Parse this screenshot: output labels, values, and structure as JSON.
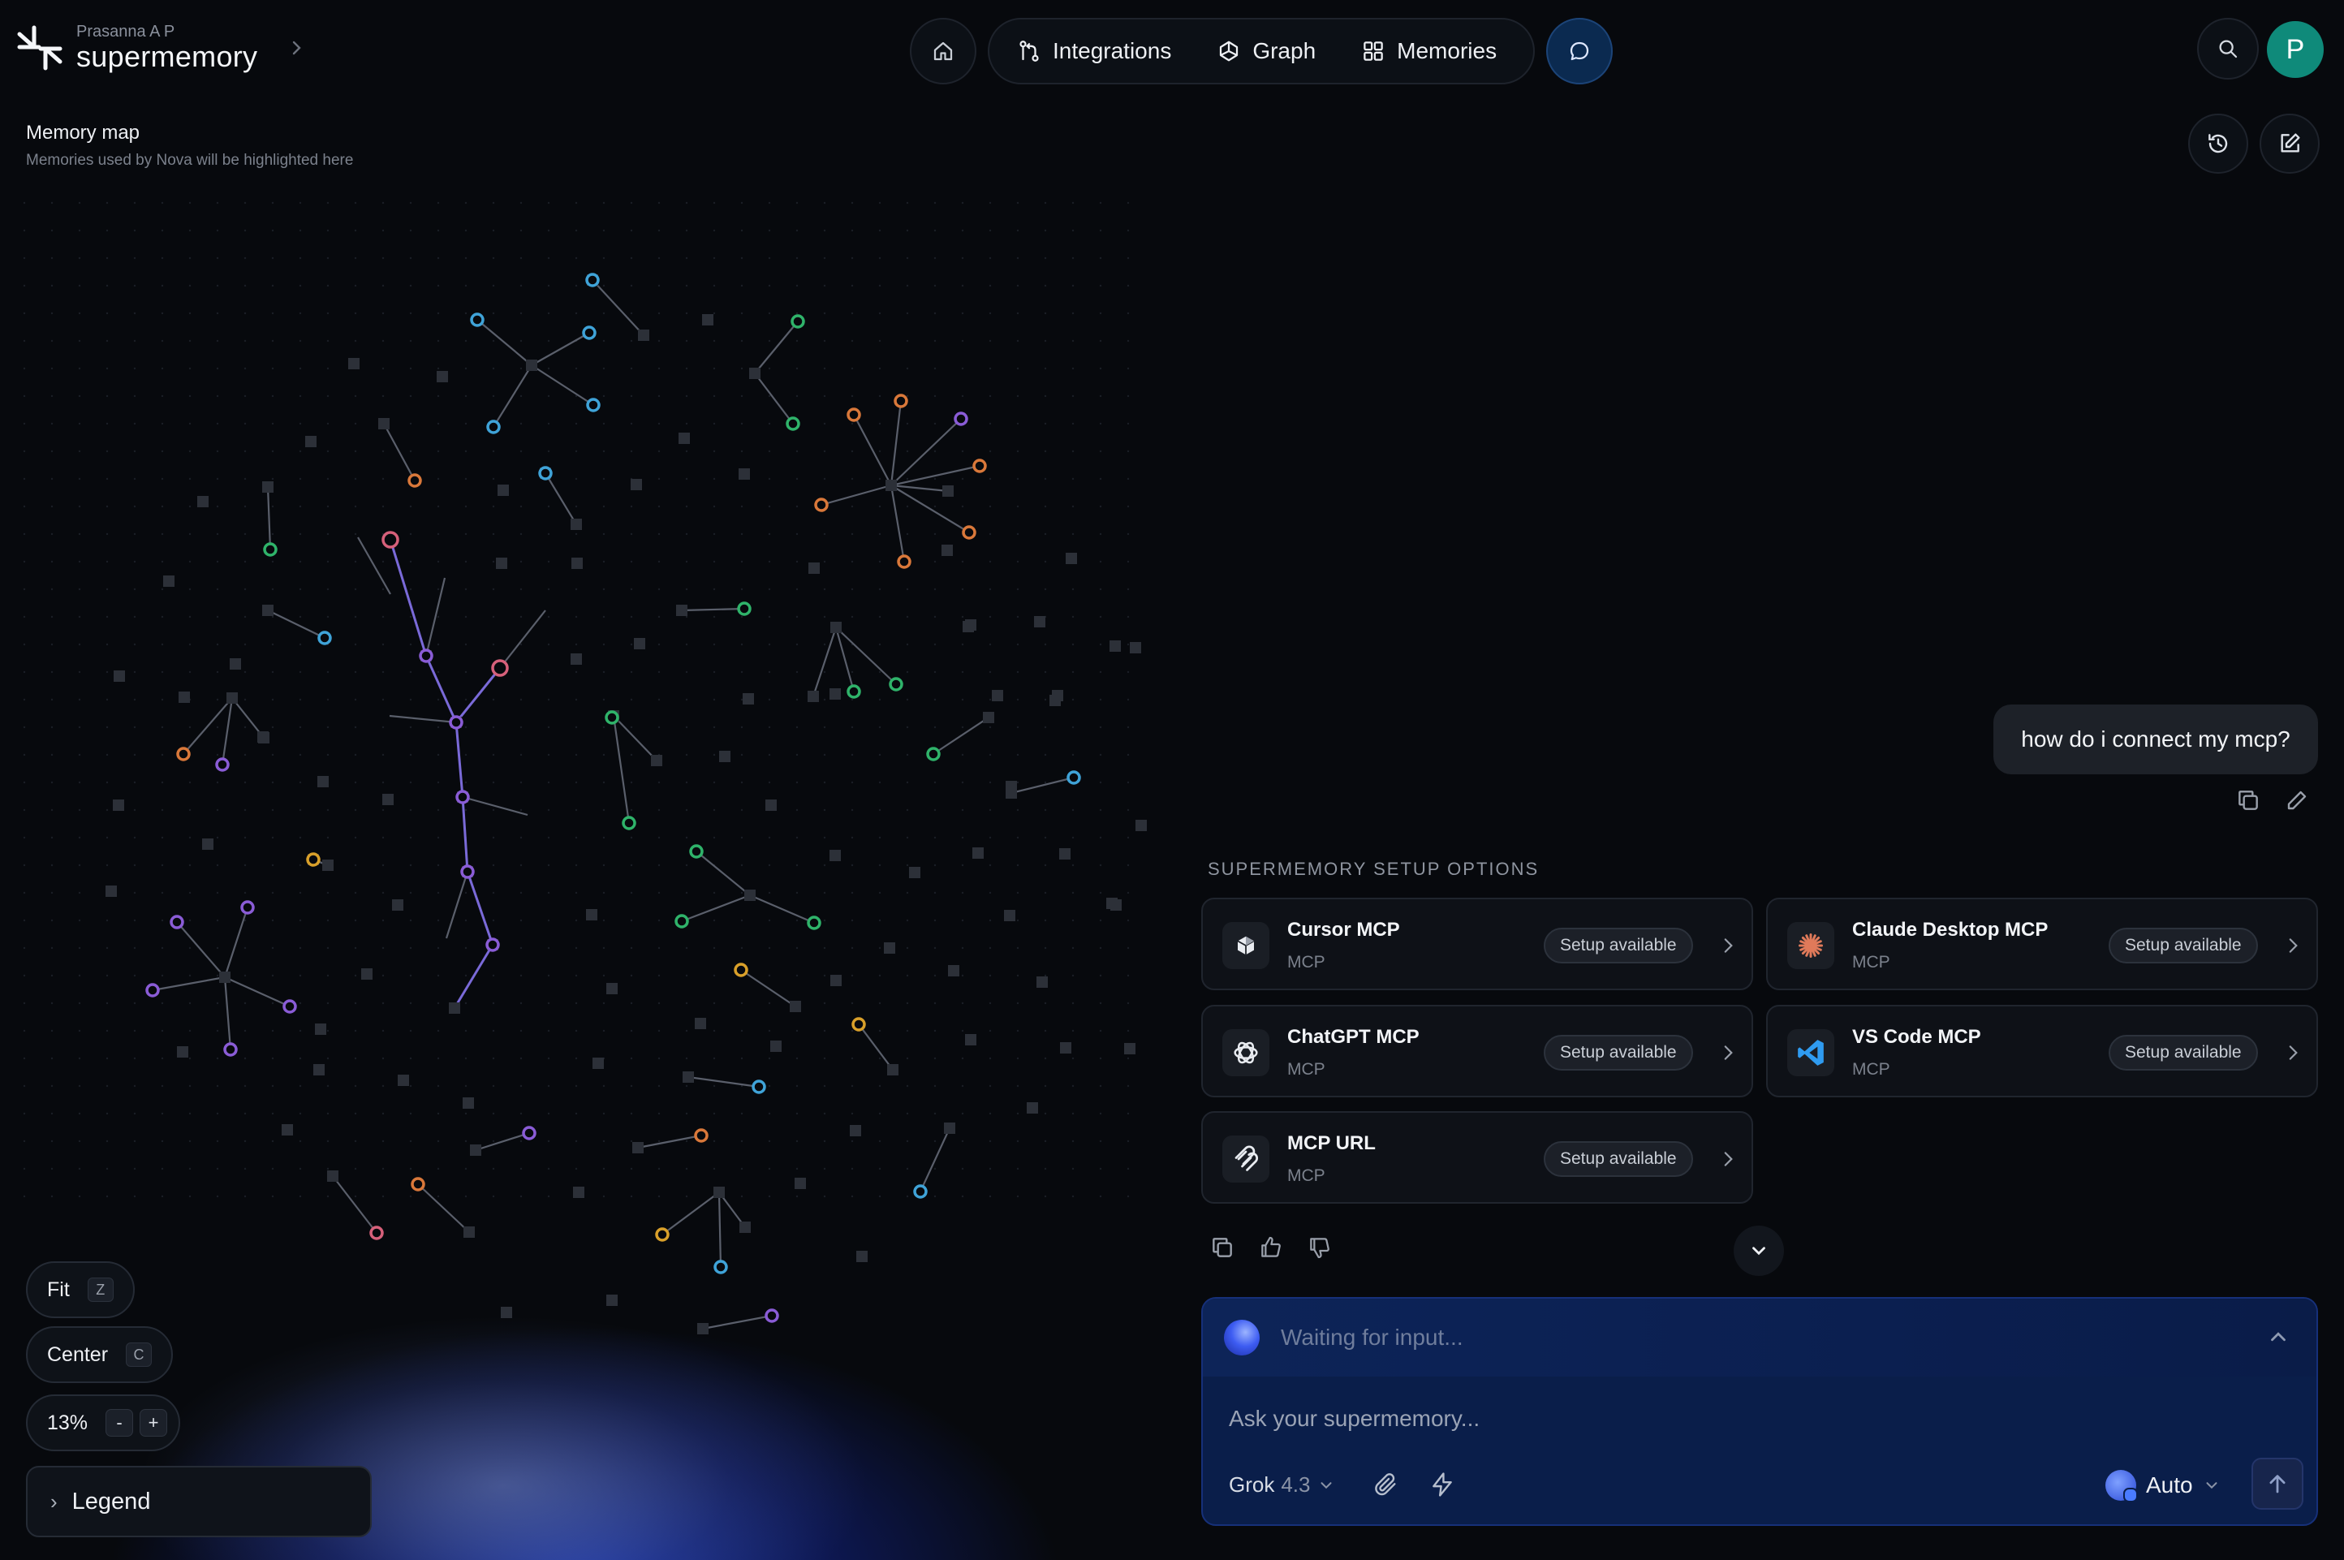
{
  "header": {
    "user": "Prasanna A P",
    "brand": "supermemory",
    "nav": {
      "integrations": "Integrations",
      "graph": "Graph",
      "memories": "Memories"
    },
    "avatar_initial": "P"
  },
  "map": {
    "title": "Memory map",
    "subtitle": "Memories used by Nova will be highlighted here",
    "controls": {
      "fit": "Fit",
      "fit_key": "Z",
      "center": "Center",
      "center_key": "C",
      "zoom": "13%",
      "zoom_out": "-",
      "zoom_in": "+",
      "legend": "Legend"
    }
  },
  "chat": {
    "user_message": "how do i connect my mcp?",
    "section_title": "SUPERMEMORY SETUP OPTIONS",
    "options": [
      {
        "title": "Cursor MCP",
        "subtitle": "MCP",
        "badge": "Setup available"
      },
      {
        "title": "Claude Desktop MCP",
        "subtitle": "MCP",
        "badge": "Setup available"
      },
      {
        "title": "ChatGPT MCP",
        "subtitle": "MCP",
        "badge": "Setup available"
      },
      {
        "title": "VS Code MCP",
        "subtitle": "MCP",
        "badge": "Setup available"
      },
      {
        "title": "MCP URL",
        "subtitle": "MCP",
        "badge": "Setup available"
      }
    ],
    "composer": {
      "status": "Waiting for input...",
      "placeholder": "Ask your supermemory...",
      "model": "Grok",
      "model_version": "4.3",
      "mode": "Auto"
    }
  },
  "colors": {
    "background": "#07090d",
    "accent_blue": "#0b2a50",
    "avatar": "#0f8a7a",
    "node_blue": "#3fa3d8",
    "node_green": "#2fb36a",
    "node_orange": "#d9783a",
    "node_purple": "#8a5cd6",
    "node_pink": "#d6607a",
    "node_yellow": "#d9a02a",
    "edge": "#5a5f6b",
    "edge_highlight": "#7a6ad8"
  }
}
